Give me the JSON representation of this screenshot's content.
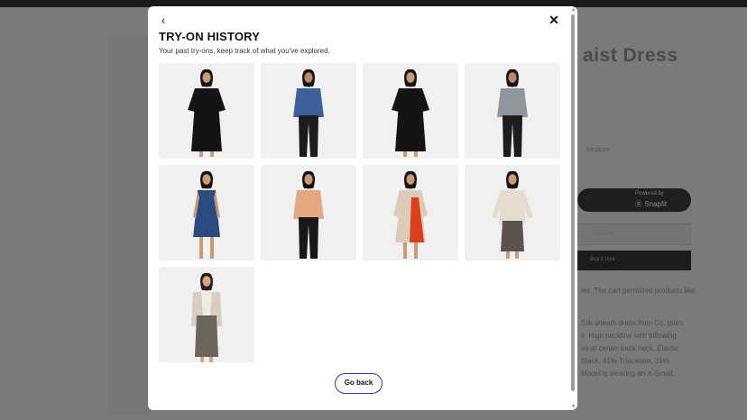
{
  "modal": {
    "back_icon": "‹",
    "close_icon": "✕",
    "title": "TRY-ON HISTORY",
    "subtitle": "Your past try-ons, keep track of what you've explored.",
    "go_back_label": "Go back",
    "items": [
      {
        "name": "black-midi-dress-woman",
        "outfit": "dress",
        "top": "#141414",
        "bottom": "#141414",
        "skin": "#c79a7a",
        "hair": "#1a1210"
      },
      {
        "name": "blue-printed-tee-man",
        "outfit": "shirt-pants",
        "top": "#3f5f9a",
        "bottom": "#1c1c1c",
        "skin": "#b88a68",
        "hair": "#1a1210"
      },
      {
        "name": "black-midi-dress-woman-2",
        "outfit": "dress",
        "top": "#141414",
        "bottom": "#141414",
        "skin": "#c79a7a",
        "hair": "#1a1210"
      },
      {
        "name": "grey-shirt-man",
        "outfit": "shirt-pants",
        "top": "#8f969c",
        "bottom": "#1c1c1c",
        "skin": "#b88a68",
        "hair": "#1a1210"
      },
      {
        "name": "blue-sheath-dress-woman",
        "outfit": "dress-short",
        "top": "#2b4a80",
        "bottom": "#2b4a80",
        "skin": "#c79a7a",
        "hair": "#1a1210"
      },
      {
        "name": "peach-top-black-pants-woman",
        "outfit": "shirt-pants",
        "top": "#e3a882",
        "bottom": "#181818",
        "skin": "#c89a7a",
        "hair": "#1a1210"
      },
      {
        "name": "printed-kurta-red-panel-woman",
        "outfit": "kurta",
        "top": "#dccbb8",
        "bottom": "#d8401c",
        "skin": "#c79a7a",
        "hair": "#1a1210"
      },
      {
        "name": "floral-top-grey-skirt-woman",
        "outfit": "top-skirt",
        "top": "#e6dbcf",
        "bottom": "#5a5450",
        "skin": "#c79a7a",
        "hair": "#1a1210"
      },
      {
        "name": "blazer-grey-skirt-woman",
        "outfit": "blazer-skirt",
        "top": "#d9cdbf",
        "bottom": "#6b645c",
        "skin": "#d1a586",
        "hair": "#2a1d14"
      }
    ]
  },
  "background": {
    "product_title": "aist Dress",
    "size_label": "Medium",
    "pill_top": "Powered by",
    "pill_main": "Ⓡ Snapfit",
    "input_placeholder": "Gift card",
    "buy_label": "Buy it now",
    "para1": "les. The cart permitted products like",
    "para2_lines": [
      "Silk sheath dress from Co. pairs",
      "s. High neckline with billowing",
      "es at center back neck. Elastic",
      "Black. 81% Triacetate, 19%",
      "Model is wearing an X-Small."
    ]
  }
}
